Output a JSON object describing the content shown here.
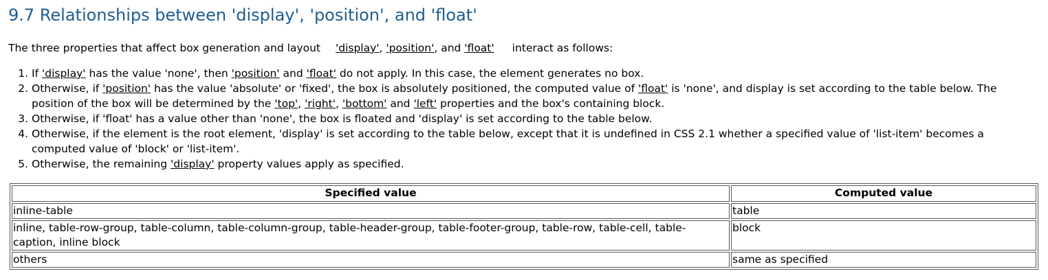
{
  "section": {
    "title": "9.7 Relationships between 'display', 'position', and 'float'"
  },
  "intro": {
    "before": "The three properties that affect box generation and layout",
    "link_display": "'display'",
    "sep1": ",",
    "link_position": "'position'",
    "sep2": ", and",
    "link_float": "'float'",
    "after": "interact as follows:"
  },
  "rules": {
    "r1": {
      "t1": "If ",
      "l1": "'display'",
      "t2": " has the value 'none', then ",
      "l2": "'position'",
      "t3": " and ",
      "l3": "'float'",
      "t4": " do not apply. In this case, the element generates no box."
    },
    "r2": {
      "t1": "Otherwise, if ",
      "l1": "'position'",
      "t2": " has the value 'absolute' or 'fixed', the box is absolutely positioned, the computed value of ",
      "l2": "'float'",
      "t3": " is 'none', and display is set according to the table below. The position of the box will be determined by the ",
      "l3": "'top'",
      "t4": ", ",
      "l4": "'right'",
      "t5": ", ",
      "l5": "'bottom'",
      "t6": " and ",
      "l6": "'left'",
      "t7": " properties and the box's containing block."
    },
    "r3": {
      "t1": "Otherwise, if 'float' has a value other than 'none', the box is floated and 'display' is set according to the table below."
    },
    "r4": {
      "t1": "Otherwise, if the element is the root element, 'display' is set according to the table below, except that it is undefined in CSS 2.1 whether a specified value of 'list-item' becomes a computed value of 'block' or 'list-item'."
    },
    "r5": {
      "t1": "Otherwise, the remaining ",
      "l1": "'display'",
      "t2": " property values apply as specified."
    }
  },
  "table": {
    "headers": [
      "Specified value",
      "Computed value"
    ],
    "rows": [
      [
        "inline-table",
        "table"
      ],
      [
        "inline, table-row-group, table-column, table-column-group, table-header-group, table-footer-group, table-row, table-cell, table-caption, inline block",
        "block"
      ],
      [
        "others",
        "same as specified"
      ]
    ]
  }
}
